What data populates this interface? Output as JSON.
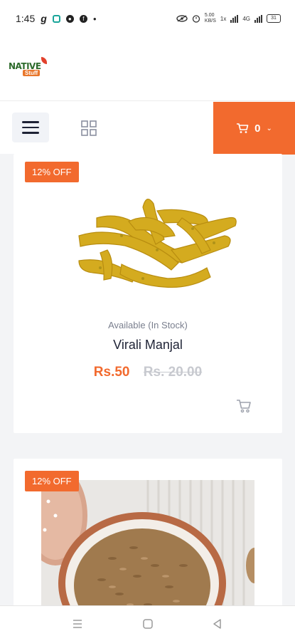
{
  "status_bar": {
    "time": "1:45",
    "app_letter": "g",
    "network_speed_top": "5.00",
    "network_speed_bottom": "KB/S",
    "signal_label": "1x",
    "data_label": "4G",
    "battery": "31"
  },
  "header": {
    "logo_main": "NATIVE",
    "logo_sub": "Stuff"
  },
  "navbar": {
    "cart_count": "0"
  },
  "products": [
    {
      "badge": "12% OFF",
      "availability": "Available  (In Stock)",
      "name": "Virali Manjal",
      "price": "Rs.50",
      "old_price": "Rs. 20.00"
    },
    {
      "badge": "12% OFF"
    }
  ],
  "colors": {
    "accent": "#f26a2e",
    "text_dark": "#1e2235",
    "muted": "#7a7f8e",
    "background": "#f3f4f6"
  }
}
